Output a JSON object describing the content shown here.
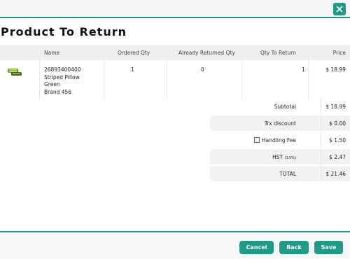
{
  "dialog": {
    "title": "Product To Return",
    "close_icon": "close-icon"
  },
  "table": {
    "headers": {
      "name": "Name",
      "ordered_qty": "Ordered Qty",
      "already_returned_qty": "Already Returned Qty",
      "qty_to_return": "Qty To Return",
      "price": "Price"
    },
    "rows": [
      {
        "sku": "26893400400",
        "description": "Striped Pillow",
        "color": "Green",
        "brand": "Brand 456",
        "ordered_qty": "1",
        "already_returned_qty": "0",
        "qty_to_return": "1",
        "price": "$ 18.99"
      }
    ]
  },
  "summary": {
    "subtotal_label": "Subtotal",
    "subtotal_value": "$ 18.99",
    "trx_discount_label": "Trx discount",
    "trx_discount_value": "$ 0.00",
    "handling_fee_label": "Handling Fee",
    "handling_fee_value": "$ 1.50",
    "handling_fee_checked": false,
    "hst_label": "HST",
    "hst_rate": "(13%)",
    "hst_value": "$ 2.47",
    "total_label": "TOTAL",
    "total_value": "$ 21.46"
  },
  "footer": {
    "cancel_label": "Cancel",
    "back_label": "Back",
    "save_label": "Save"
  },
  "colors": {
    "accent": "#1f9a86"
  }
}
